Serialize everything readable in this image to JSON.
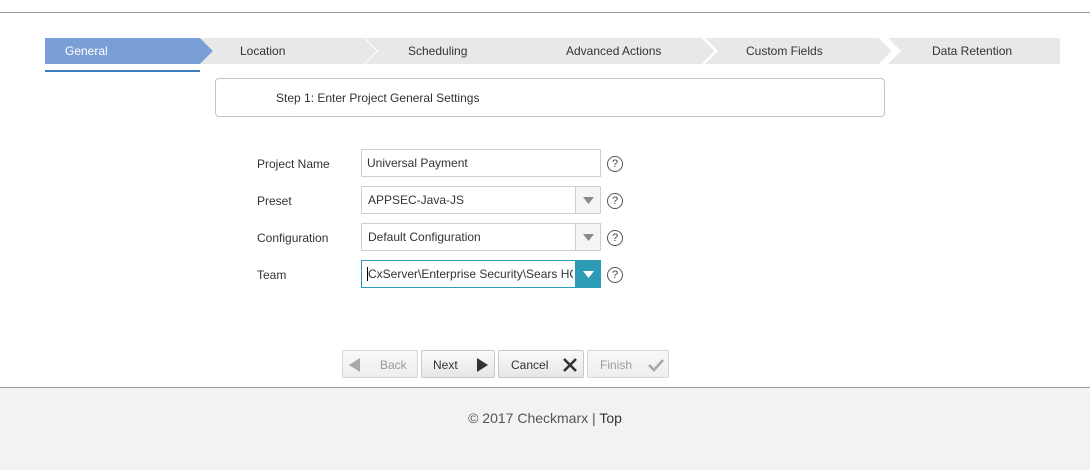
{
  "wizard": {
    "steps": [
      {
        "label": "General",
        "active": true
      },
      {
        "label": "Location",
        "active": false
      },
      {
        "label": "Scheduling",
        "active": false
      },
      {
        "label": "Advanced Actions",
        "active": false
      },
      {
        "label": "Custom Fields",
        "active": false
      },
      {
        "label": "Data Retention",
        "active": false
      }
    ]
  },
  "step_heading": "Step 1: Enter Project General Settings",
  "form": {
    "project_name": {
      "label": "Project Name",
      "value": "Universal Payment"
    },
    "preset": {
      "label": "Preset",
      "value": "APPSEC-Java-JS"
    },
    "configuration": {
      "label": "Configuration",
      "value": "Default Configuration"
    },
    "team": {
      "label": "Team",
      "value": "CxServer\\Enterprise Security\\Sears HC\\"
    },
    "help_glyph": "?"
  },
  "buttons": {
    "back": "Back",
    "next": "Next",
    "cancel": "Cancel",
    "finish": "Finish"
  },
  "footer": {
    "copyright": "© 2017 Checkmarx",
    "separator": " | ",
    "top_link": "Top"
  },
  "colors": {
    "active_step": "#7a9fd6",
    "inactive_step": "#e8e8e8",
    "team_focus": "#2b9bb6"
  }
}
